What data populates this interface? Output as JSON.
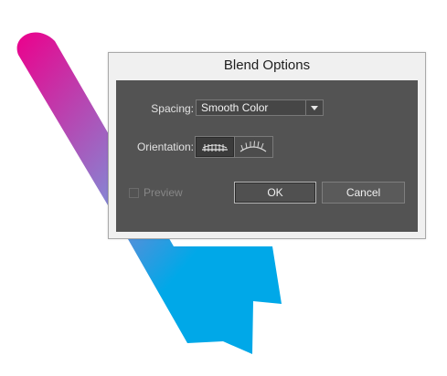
{
  "dialog": {
    "title": "Blend Options",
    "spacing": {
      "label": "Spacing:",
      "selected": "Smooth Color"
    },
    "orientation": {
      "label": "Orientation:",
      "options": [
        {
          "icon": "align-to-page-icon",
          "selected": true
        },
        {
          "icon": "align-to-path-icon",
          "selected": false
        }
      ]
    },
    "preview": {
      "label": "Preview",
      "checked": false,
      "enabled": false
    },
    "buttons": {
      "ok": "OK",
      "cancel": "Cancel"
    }
  },
  "artwork": {
    "gradient_colors": [
      "#ec008c",
      "#8b7fd0",
      "#00a8e8"
    ]
  }
}
